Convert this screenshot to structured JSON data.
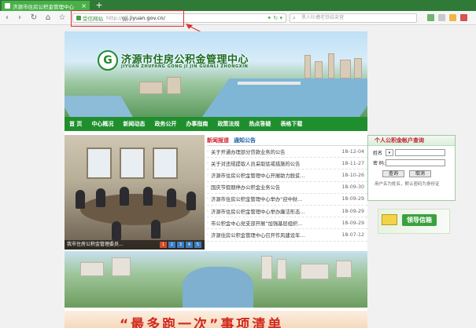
{
  "browser": {
    "tab_title": "济源市住房公积金管理中心",
    "tab_close": "×",
    "new_tab": "+",
    "back": "‹",
    "forward": "›",
    "reload": "↻",
    "home": "⌂",
    "bookmark": "☆",
    "secure_label": "受信网站",
    "url_proto": "http://",
    "url_domain": "gjj.jiyuan.gov.cn/",
    "search_placeholder": "黑人吐槽老铁结束营"
  },
  "site": {
    "title": "济源市住房公积金管理中心",
    "pinyin": "JIYUAN ZHUFANG GONG JI JIN GUANLI ZHONGXIN",
    "logo_char": "G"
  },
  "nav": {
    "items": [
      "首 页",
      "中心概况",
      "新闻动态",
      "政务公开",
      "办事指南",
      "政策法规",
      "热点答疑",
      "表格下载"
    ]
  },
  "slider": {
    "caption": "我市住房公积金管理委员...",
    "pages": [
      "1",
      "2",
      "3",
      "4",
      "5"
    ]
  },
  "news": {
    "tab_a": "新闻报道",
    "tab_b": "通知公告",
    "items": [
      {
        "title": "关于开通办理部分贷款业务的公告",
        "date": "18-12-04"
      },
      {
        "title": "关于对违规提取人员采取惩戒措施的公告",
        "date": "18-11-27"
      },
      {
        "title": "济源市住房公积金管理中心开展助力脱贫...",
        "date": "18-10-26"
      },
      {
        "title": "国庆节假期停办公积金业务公告",
        "date": "18-09-30"
      },
      {
        "title": "济源市住房公积金管理中心举办“迎中秋...",
        "date": "18-09-29"
      },
      {
        "title": "济源市住房公积金管理中心举办廉洁形态...",
        "date": "18-09-29"
      },
      {
        "title": "市公积金中心党支部开展“加强基层组织...",
        "date": "18-09-29"
      },
      {
        "title": "济源住房公积金管理中心召开作风建设年...",
        "date": "18-07-12"
      }
    ]
  },
  "login": {
    "title": "个人公积金帐户查询",
    "name_label": "姓名",
    "password_label": "密 码:",
    "query_btn": "查询",
    "cancel_btn": "取消",
    "note": "用户名为姓名，默认密码为身份证"
  },
  "mailbox": {
    "label": "领导信箱"
  },
  "notice": {
    "text": "“最多跑一次”事项清单"
  }
}
